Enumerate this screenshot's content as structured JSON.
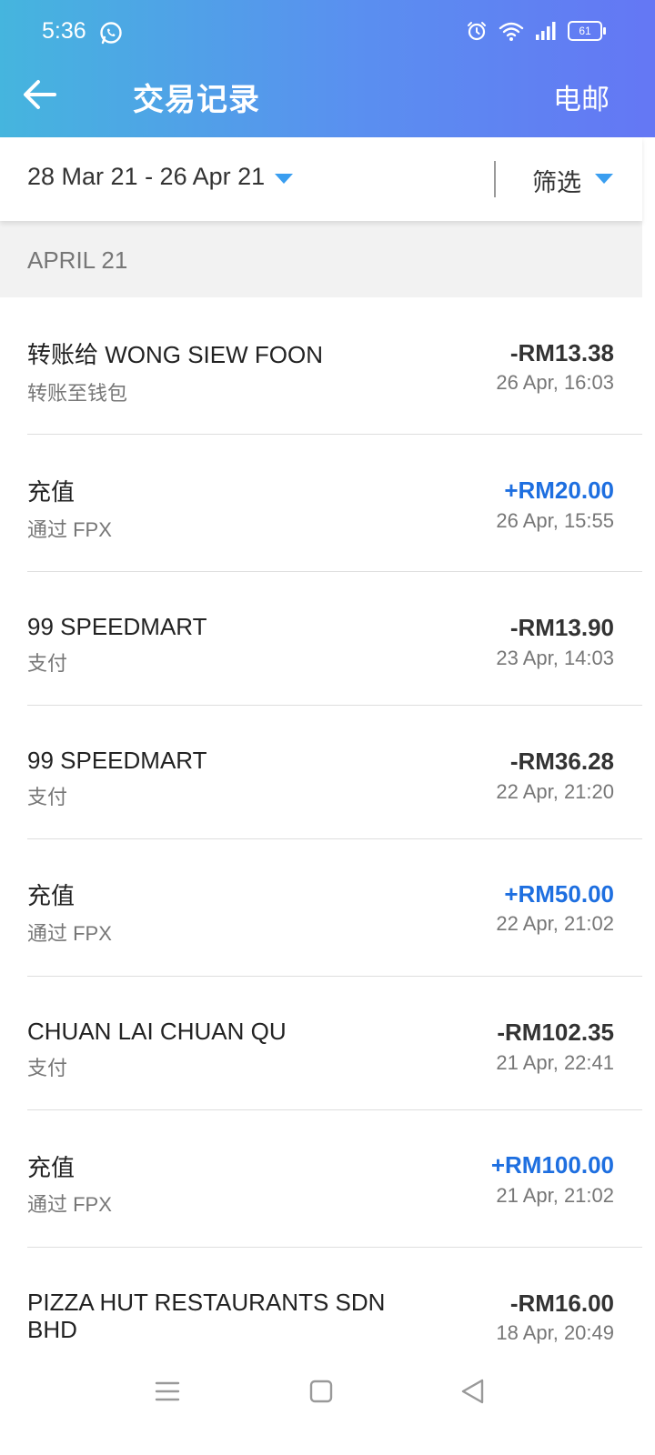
{
  "status_bar": {
    "time": "5:36",
    "battery": "61",
    "icons": [
      "whatsapp-icon",
      "alarm-icon",
      "wifi-icon",
      "signal-icon",
      "battery-icon"
    ]
  },
  "app_bar": {
    "title": "交易记录",
    "action": "电邮",
    "back_icon": "back-arrow-icon"
  },
  "filter_bar": {
    "date_range": "28 Mar 21 - 26 Apr 21",
    "filter_label": "筛选",
    "accent": "#3a9ef0"
  },
  "section": {
    "month": "APRIL 21"
  },
  "colors": {
    "header_start": "#45b5de",
    "header_end": "#6477f4",
    "credit": "#1e6fe0",
    "debit": "#333333"
  },
  "transactions": [
    {
      "title": "转账给 WONG SIEW FOON",
      "subtitle": "转账至钱包",
      "amount": "-RM13.38",
      "date": "26 Apr, 16:03",
      "type": "debit"
    },
    {
      "title": "充值",
      "subtitle": "通过 FPX",
      "amount": "+RM20.00",
      "date": "26 Apr, 15:55",
      "type": "credit"
    },
    {
      "title": "99 SPEEDMART",
      "subtitle": "支付",
      "amount": "-RM13.90",
      "date": "23 Apr, 14:03",
      "type": "debit"
    },
    {
      "title": "99 SPEEDMART",
      "subtitle": "支付",
      "amount": "-RM36.28",
      "date": "22 Apr, 21:20",
      "type": "debit"
    },
    {
      "title": "充值",
      "subtitle": "通过 FPX",
      "amount": "+RM50.00",
      "date": "22 Apr, 21:02",
      "type": "credit"
    },
    {
      "title": "CHUAN LAI CHUAN QU",
      "subtitle": "支付",
      "amount": "-RM102.35",
      "date": "21 Apr, 22:41",
      "type": "debit"
    },
    {
      "title": "充值",
      "subtitle": "通过 FPX",
      "amount": "+RM100.00",
      "date": "21 Apr, 21:02",
      "type": "credit"
    },
    {
      "title": "PIZZA HUT RESTAURANTS SDN BHD",
      "subtitle": "",
      "amount": "-RM16.00",
      "date": "18 Apr, 20:49",
      "type": "debit"
    }
  ],
  "nav_bar": {
    "icons": [
      "menu-icon",
      "home-square-icon",
      "back-triangle-icon"
    ]
  }
}
